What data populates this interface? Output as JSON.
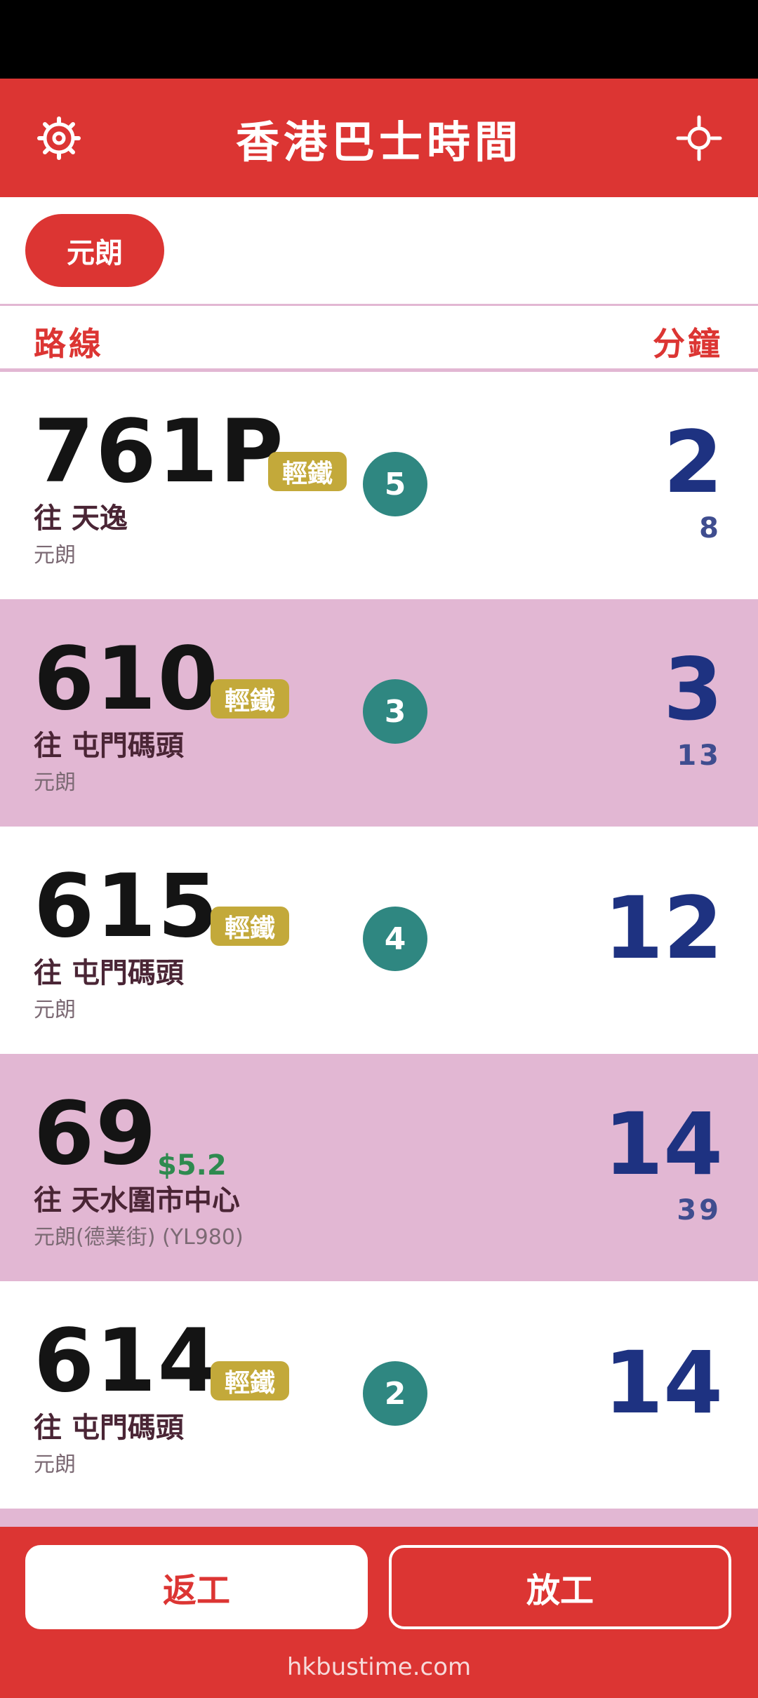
{
  "header": {
    "title": "香港巴士時間",
    "left_icon": "settings-gear-icon",
    "right_icon": "locate-crosshair-icon"
  },
  "filter_chip": "元朗",
  "columns": {
    "route": "路線",
    "minutes": "分鐘"
  },
  "rows": [
    {
      "route": "761P",
      "badge": "輕鐵",
      "circle": "5",
      "fare": "",
      "dest": "往 天逸",
      "stop": "元朗",
      "mins": "2",
      "next": "8",
      "alt": false
    },
    {
      "route": "610",
      "badge": "輕鐵",
      "circle": "3",
      "fare": "",
      "dest": "往 屯門碼頭",
      "stop": "元朗",
      "mins": "3",
      "next": "13",
      "alt": true
    },
    {
      "route": "615",
      "badge": "輕鐵",
      "circle": "4",
      "fare": "",
      "dest": "往 屯門碼頭",
      "stop": "元朗",
      "mins": "12",
      "next": "",
      "alt": false
    },
    {
      "route": "69",
      "badge": "",
      "circle": "",
      "fare": "$5.2",
      "dest": "往 天水圍市中心",
      "stop": "元朗(德業街) (YL980)",
      "mins": "14",
      "next": "39",
      "alt": true
    },
    {
      "route": "614",
      "badge": "輕鐵",
      "circle": "2",
      "fare": "",
      "dest": "往 屯門碼頭",
      "stop": "元朗",
      "mins": "14",
      "next": "",
      "alt": false
    }
  ],
  "bottom": {
    "work_label": "返工",
    "off_label": "放工",
    "site": "hkbustime.com"
  },
  "colors": {
    "primary_red": "#dc3533",
    "alt_row": "#e2b7d3",
    "minutes_blue": "#1e3281",
    "light_rail_gold": "#c3a93a",
    "circle_teal": "#2f8781",
    "fare_green": "#2e8a4f"
  }
}
